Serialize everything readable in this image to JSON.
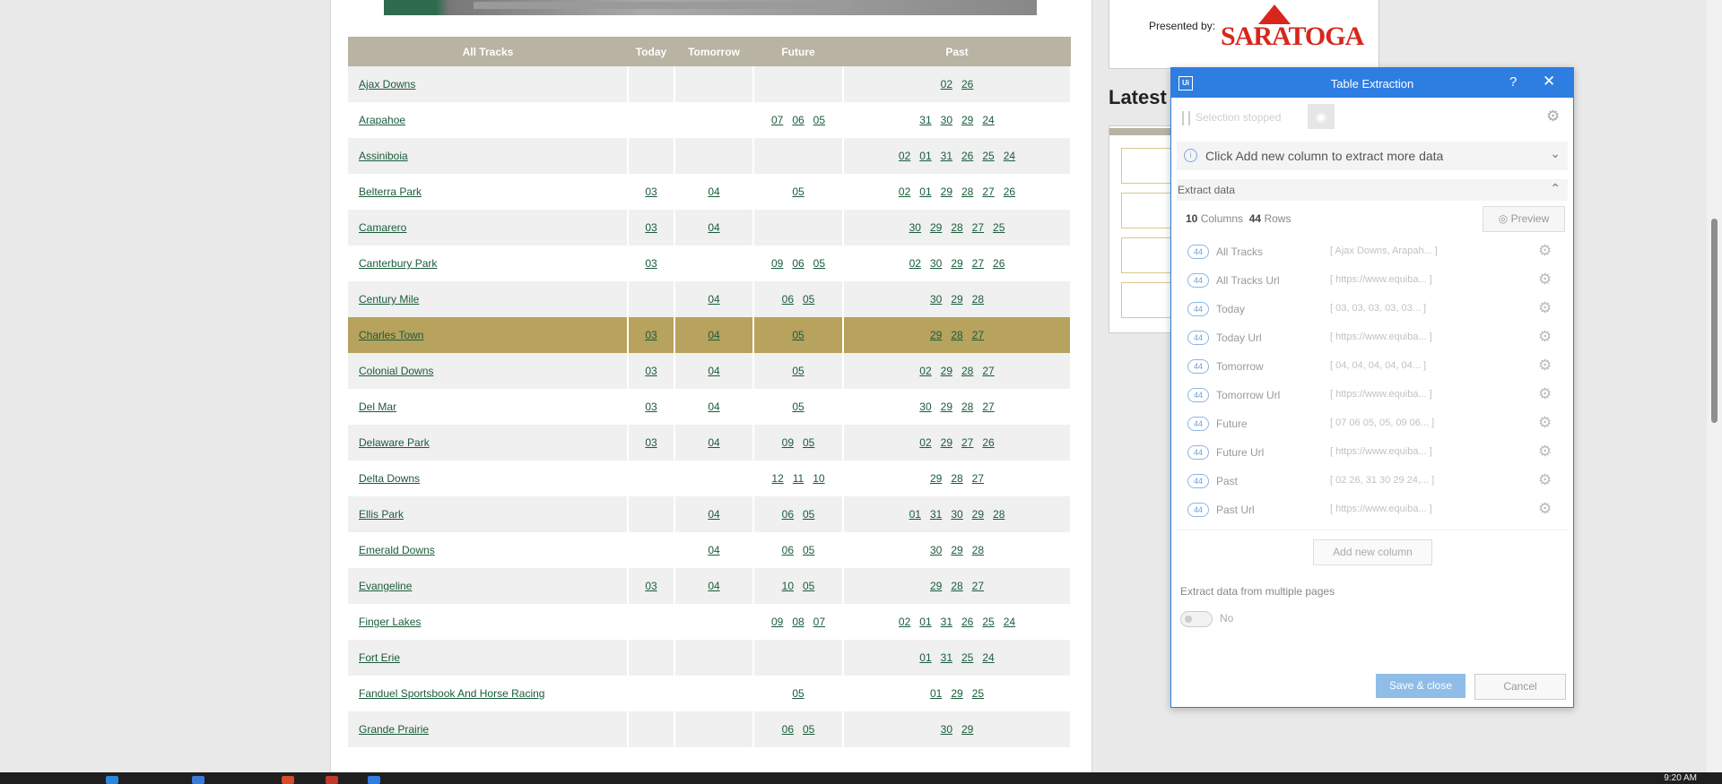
{
  "table": {
    "headers": [
      "All Tracks",
      "Today",
      "Tomorrow",
      "Future",
      "Past"
    ],
    "rows": [
      {
        "name": "Ajax Downs",
        "today": [],
        "tomorrow": [],
        "future": [],
        "past": [
          "02",
          "26"
        ]
      },
      {
        "name": "Arapahoe",
        "today": [],
        "tomorrow": [],
        "future": [
          "07",
          "06",
          "05"
        ],
        "past": [
          "31",
          "30",
          "29",
          "24"
        ]
      },
      {
        "name": "Assiniboia",
        "today": [],
        "tomorrow": [],
        "future": [],
        "past": [
          "02",
          "01",
          "31",
          "26",
          "25",
          "24"
        ]
      },
      {
        "name": "Belterra Park",
        "today": [
          "03"
        ],
        "tomorrow": [
          "04"
        ],
        "future": [
          "05"
        ],
        "past": [
          "02",
          "01",
          "29",
          "28",
          "27",
          "26"
        ]
      },
      {
        "name": "Camarero",
        "today": [
          "03"
        ],
        "tomorrow": [
          "04"
        ],
        "future": [],
        "past": [
          "30",
          "29",
          "28",
          "27",
          "25"
        ]
      },
      {
        "name": "Canterbury Park",
        "today": [
          "03"
        ],
        "tomorrow": [],
        "future": [
          "09",
          "06",
          "05"
        ],
        "past": [
          "02",
          "30",
          "29",
          "27",
          "26"
        ]
      },
      {
        "name": "Century Mile",
        "today": [],
        "tomorrow": [
          "04"
        ],
        "future": [
          "06",
          "05"
        ],
        "past": [
          "30",
          "29",
          "28"
        ]
      },
      {
        "name": "Charles Town",
        "today": [
          "03"
        ],
        "tomorrow": [
          "04"
        ],
        "future": [
          "05"
        ],
        "past": [
          "29",
          "28",
          "27"
        ],
        "highlight": true
      },
      {
        "name": "Colonial Downs",
        "today": [
          "03"
        ],
        "tomorrow": [
          "04"
        ],
        "future": [
          "05"
        ],
        "past": [
          "02",
          "29",
          "28",
          "27"
        ]
      },
      {
        "name": "Del Mar",
        "today": [
          "03"
        ],
        "tomorrow": [
          "04"
        ],
        "future": [
          "05"
        ],
        "past": [
          "30",
          "29",
          "28",
          "27"
        ]
      },
      {
        "name": "Delaware Park",
        "today": [
          "03"
        ],
        "tomorrow": [
          "04"
        ],
        "future": [
          "09",
          "05"
        ],
        "past": [
          "02",
          "29",
          "27",
          "26"
        ]
      },
      {
        "name": "Delta Downs",
        "today": [],
        "tomorrow": [],
        "future": [
          "12",
          "11",
          "10"
        ],
        "past": [
          "29",
          "28",
          "27"
        ]
      },
      {
        "name": "Ellis Park",
        "today": [],
        "tomorrow": [
          "04"
        ],
        "future": [
          "06",
          "05"
        ],
        "past": [
          "01",
          "31",
          "30",
          "29",
          "28"
        ]
      },
      {
        "name": "Emerald Downs",
        "today": [],
        "tomorrow": [
          "04"
        ],
        "future": [
          "06",
          "05"
        ],
        "past": [
          "30",
          "29",
          "28"
        ]
      },
      {
        "name": "Evangeline",
        "today": [
          "03"
        ],
        "tomorrow": [
          "04"
        ],
        "future": [
          "10",
          "05"
        ],
        "past": [
          "29",
          "28",
          "27"
        ]
      },
      {
        "name": "Finger Lakes",
        "today": [],
        "tomorrow": [],
        "future": [
          "09",
          "08",
          "07"
        ],
        "past": [
          "02",
          "01",
          "31",
          "26",
          "25",
          "24"
        ]
      },
      {
        "name": "Fort Erie",
        "today": [],
        "tomorrow": [],
        "future": [],
        "past": [
          "01",
          "31",
          "25",
          "24"
        ]
      },
      {
        "name": "Fanduel Sportsbook And Horse Racing",
        "today": [],
        "tomorrow": [],
        "future": [
          "05"
        ],
        "past": [
          "01",
          "29",
          "25"
        ]
      },
      {
        "name": "Grande Prairie",
        "today": [],
        "tomorrow": [],
        "future": [
          "06",
          "05"
        ],
        "past": [
          "30",
          "29"
        ]
      }
    ]
  },
  "sponsor": {
    "presented_by": "Presented by:",
    "logo_text": "SARATOGA"
  },
  "latest": {
    "heading": "Latest"
  },
  "dialog": {
    "title": "Table Extraction",
    "help": "?",
    "close": "✕",
    "selection_status": "Selection stopped",
    "info_text": "Click Add new column to extract more data",
    "extract_header": "Extract data",
    "columns_count": "10",
    "columns_label": "Columns",
    "rows_count": "44",
    "rows_label": "Rows",
    "preview_label": "Preview",
    "columns": [
      {
        "count": "44",
        "name": "All Tracks",
        "preview": "[ Ajax Downs, Arapah... ]"
      },
      {
        "count": "44",
        "name": "All Tracks Url",
        "preview": "[ https://www.equiba... ]"
      },
      {
        "count": "44",
        "name": "Today",
        "preview": "[ 03, 03, 03, 03, 03... ]"
      },
      {
        "count": "44",
        "name": "Today Url",
        "preview": "[ https://www.equiba... ]"
      },
      {
        "count": "44",
        "name": "Tomorrow",
        "preview": "[ 04, 04, 04, 04, 04... ]"
      },
      {
        "count": "44",
        "name": "Tomorrow Url",
        "preview": "[ https://www.equiba... ]"
      },
      {
        "count": "44",
        "name": "Future",
        "preview": "[ 07 06 05, 05, 09 06... ]"
      },
      {
        "count": "44",
        "name": "Future Url",
        "preview": "[ https://www.equiba... ]"
      },
      {
        "count": "44",
        "name": "Past",
        "preview": "[ 02 26, 31 30 29 24,... ]"
      },
      {
        "count": "44",
        "name": "Past Url",
        "preview": "[ https://www.equiba... ]"
      }
    ],
    "add_column_label": "Add new column",
    "multi_pages_label": "Extract data from multiple pages",
    "multi_pages_value": "No",
    "save_label": "Save & close",
    "cancel_label": "Cancel"
  },
  "taskbar": {
    "clock": "9:20 AM"
  },
  "colors": {
    "accent": "#2e7de1",
    "header_bg": "#b8b3a2",
    "highlight": "#b7a25e",
    "link": "#1a5c3a"
  }
}
